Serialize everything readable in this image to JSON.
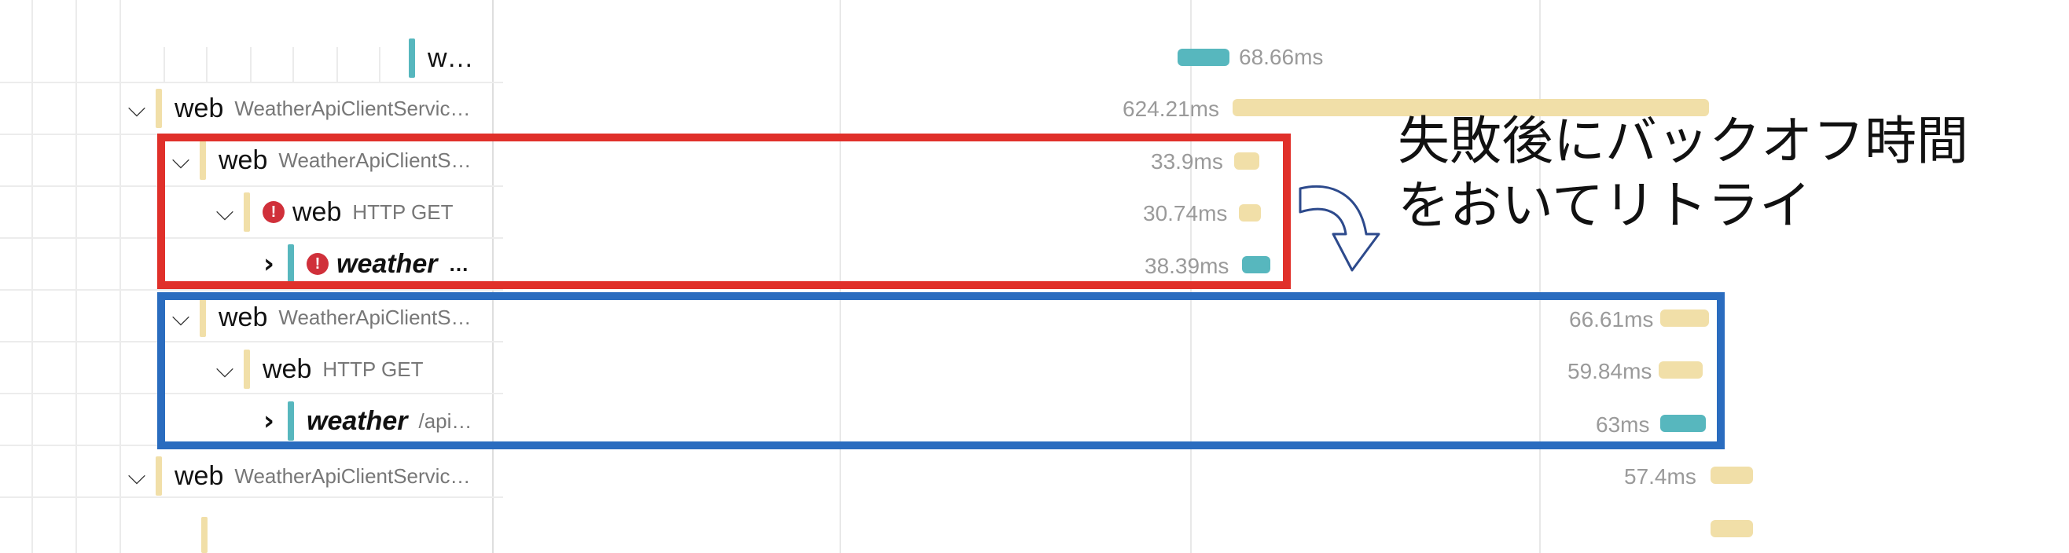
{
  "colors": {
    "tan": "#f1dfa8",
    "teal": "#57b7be",
    "red_box": "#e0302a",
    "blue_box": "#2a6cbf",
    "error": "#d0303a"
  },
  "rows": [
    {
      "service": "w…",
      "operation": "",
      "duration": "68.66ms",
      "bar_color": "teal",
      "expand": "none",
      "error": false
    },
    {
      "service": "web",
      "operation": "WeatherApiClientServic…",
      "duration": "624.21ms",
      "bar_color": "tan",
      "expand": "open",
      "error": false
    },
    {
      "service": "web",
      "operation": "WeatherApiClientS…",
      "duration": "33.9ms",
      "bar_color": "tan",
      "expand": "open",
      "error": false
    },
    {
      "service": "web",
      "operation": "HTTP GET",
      "duration": "30.74ms",
      "bar_color": "tan",
      "expand": "open",
      "error": true
    },
    {
      "service": "weather",
      "operation": "…",
      "duration": "38.39ms",
      "bar_color": "teal",
      "expand": "closed",
      "error": true
    },
    {
      "service": "web",
      "operation": "WeatherApiClientS…",
      "duration": "66.61ms",
      "bar_color": "tan",
      "expand": "open",
      "error": false
    },
    {
      "service": "web",
      "operation": "HTTP GET",
      "duration": "59.84ms",
      "bar_color": "tan",
      "expand": "open",
      "error": false
    },
    {
      "service": "weather",
      "operation": "/api…",
      "duration": "63ms",
      "bar_color": "teal",
      "expand": "closed",
      "error": false
    },
    {
      "service": "web",
      "operation": "WeatherApiClientServic…",
      "duration": "57.4ms",
      "bar_color": "tan",
      "expand": "open",
      "error": false
    }
  ],
  "annotation": {
    "line1": "失敗後にバックオフ時間",
    "line2": "をおいてリトライ"
  },
  "icons": {
    "expand_open": "chevron-down-icon",
    "expand_closed": "chevron-right-icon",
    "error": "error-icon",
    "arrow": "curved-arrow-icon"
  },
  "glyphs": {
    "chevron_down": "⌵",
    "chevron_right": "›",
    "error": "!"
  }
}
